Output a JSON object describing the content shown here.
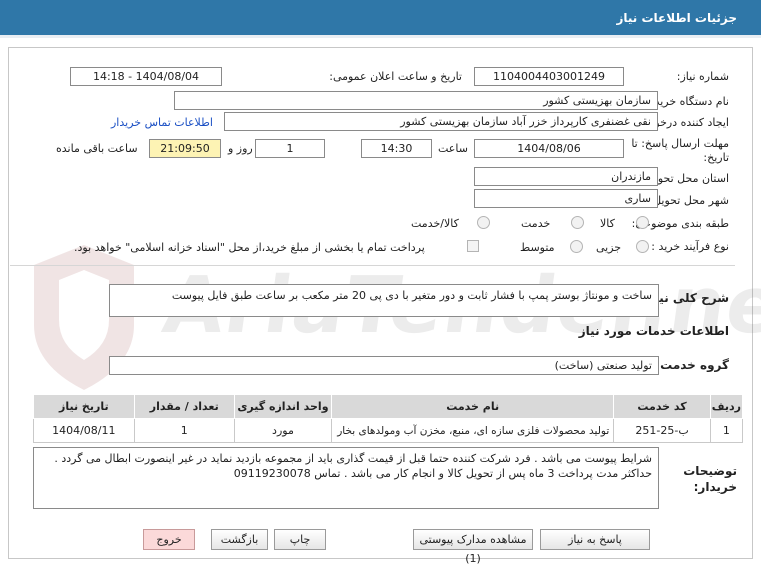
{
  "page_title": "جزئیات اطلاعات نیاز",
  "watermark_text": "AriaTender.net",
  "fields": {
    "need_number_label": "شماره نیاز:",
    "need_number": "1104004403001249",
    "announce_label": "تاریخ و ساعت اعلان عمومی:",
    "announce_value": "1404/08/04 - 14:18",
    "buyer_org_label": "نام دستگاه خریدار:",
    "buyer_org": "سازمان بهزیستی کشور",
    "creator_label": "ایجاد کننده درخواست:",
    "creator": "نقی غضنفری کارپرداز خزر آباد سازمان بهزیستی کشور",
    "contact_link": "اطلاعات تماس خریدار",
    "deadline_label": "مهلت ارسال پاسخ: تا تاریخ:",
    "deadline_date": "1404/08/06",
    "time_label": "ساعت",
    "deadline_time": "14:30",
    "days_value": "1",
    "days_label": "روز و",
    "remaining_time": "21:09:50",
    "remaining_label": "ساعت باقی مانده",
    "province_label": "استان محل تحویل:",
    "province": "مازندران",
    "city_label": "شهر محل تحویل:",
    "city": "ساری",
    "category_label": "طبقه بندی موضوعی:",
    "category_options": [
      "کالا",
      "خدمت",
      "کالا/خدمت"
    ],
    "process_label": "نوع فرآیند خرید :",
    "process_options": [
      "جزیی",
      "متوسط"
    ],
    "payment_note": "پرداخت تمام یا بخشی از مبلغ خرید،از محل \"اسناد خزانه اسلامی\" خواهد بود."
  },
  "general_desc": {
    "label": "شرح کلی نیاز:",
    "value": "ساخت و مونتاژ بوستر پمپ با فشار ثابت و دور متغیر با دی پی 20 متر مکعب بر ساعت طبق فایل پیوست"
  },
  "services_section_title": "اطلاعات خدمات مورد نیاز",
  "service_group": {
    "label": "گروه خدمت:",
    "value": "تولید صنعتی (ساخت)"
  },
  "table": {
    "headers": [
      "ردیف",
      "کد خدمت",
      "نام خدمت",
      "واحد اندازه گیری",
      "تعداد / مقدار",
      "تاریخ نیاز"
    ],
    "rows": [
      [
        "1",
        "ب-25-251",
        "تولید محصولات فلزی سازه ای، منبع، مخزن آب ومولدهای بخار",
        "مورد",
        "1",
        "1404/08/11"
      ]
    ]
  },
  "buyer_notes": {
    "label": "توضیحات خریدار:",
    "value": "شرایط پیوست می باشد . فرد شرکت کننده حتما قبل از قیمت گذاری باید از مجموعه بازدید نماید در غیر اینصورت ابطال می گردد . حداکثر مدت پرداخت 3 ماه پس از تحویل کالا و انجام کار می باشد . تماس 09119230078"
  },
  "buttons": {
    "reply": "پاسخ به نیاز",
    "attachments": "مشاهده مدارک پیوستی (1)",
    "print": "چاپ",
    "back": "بازگشت",
    "exit": "خروج"
  }
}
